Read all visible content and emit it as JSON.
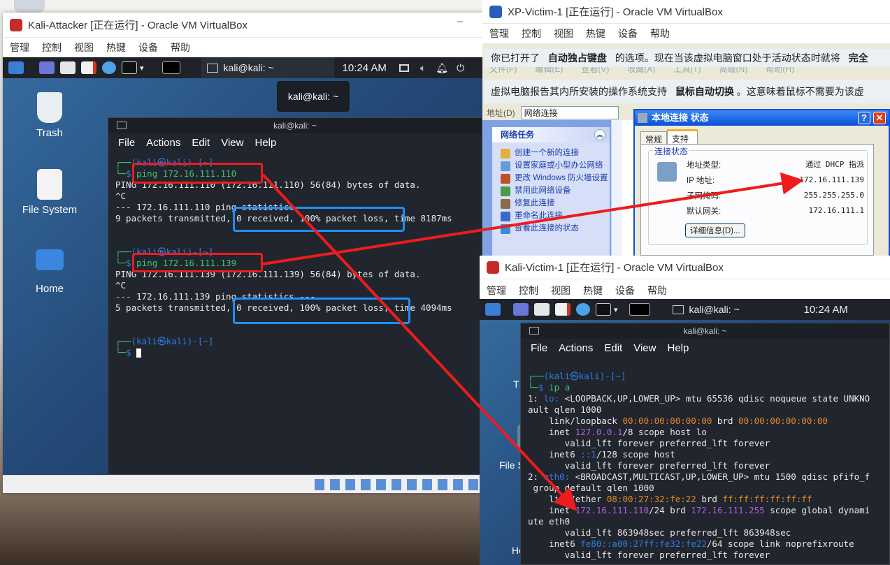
{
  "kali_attacker": {
    "title": "Kali-Attacker [正在运行] - Oracle VM VirtualBox",
    "menu": [
      "管理",
      "控制",
      "视图",
      "热键",
      "设备",
      "帮助"
    ],
    "panel_task": "kali@kali: ~",
    "clock": "10:24 AM",
    "tooltip": "kali@kali: ~",
    "desktop_icons": [
      "Trash",
      "File System",
      "Home"
    ],
    "terminal": {
      "title": "kali@kali: ~",
      "menu": [
        "File",
        "Actions",
        "Edit",
        "View",
        "Help"
      ],
      "prompt1_user": "(kali㉿kali)-[~]",
      "cmd1": "ping 172.16.111.110",
      "out1_1": "PING 172.16.111.110 (172.16.111.110) 56(84) bytes of data.",
      "out1_2": "^C",
      "out1_3": "--- 172.16.111.110 ping statistics ---",
      "out1_4a": "9 packets transmitted,",
      "out1_4b": " 0 received, 100% packet loss,",
      "out1_4c": " time 8187ms",
      "prompt2_user": "(kali㉿kali)-[~]",
      "cmd2": "ping 172.16.111.139",
      "out2_1": "PING 172.16.111.139 (172.16.111.139) 56(84) bytes of data.",
      "out2_2": "^C",
      "out2_3": "--- 172.16.111.139 ping statistics ---",
      "out2_4a": "5 packets transmitted,",
      "out2_4b": " 0 received, 100% packet loss,",
      "out2_4c": " time 4094ms",
      "prompt3_user": "(kali㉿kali)-[~]",
      "prompt_symbol": "$"
    }
  },
  "xp_victim": {
    "title": "XP-Victim-1 [正在运行] - Oracle VM VirtualBox",
    "menu": [
      "管理",
      "控制",
      "视图",
      "热键",
      "设备",
      "帮助"
    ],
    "notice1_a": "你已打开了",
    "notice1_b": "自动独占键盘",
    "notice1_c": "的选项。现在当该虚拟电脑窗口处于活动状态时就将",
    "notice1_d": "完全",
    "notice2_a": "虚拟电脑报告其内所安装的操作系统支持",
    "notice2_b": "鼠标自动切换",
    "notice2_c": "。这意味着鼠标不需要为该虚",
    "xp_menu_ghost": [
      "文件(F)",
      "编辑(E)",
      "查看(V)",
      "收藏(A)",
      "工具(T)",
      "高级(N)",
      "帮助(H)"
    ],
    "address_label": "地址(D)",
    "address_value": "网络连接",
    "tasks_header": "网络任务",
    "tasks": [
      "创建一个新的连接",
      "设置家庭或小型办公网络",
      "更改 Windows 防火墙设置",
      "禁用此网络设备",
      "修复此连接",
      "重命名此连接",
      "查看此连接的状态"
    ],
    "dialog": {
      "title": "本地连接 状态",
      "tabs": [
        "常规",
        "支持"
      ],
      "group": "连接状态",
      "rows": [
        {
          "label": "地址类型:",
          "value": "通过 DHCP 指派"
        },
        {
          "label": "IP 地址:",
          "value": "172.16.111.139"
        },
        {
          "label": "子网掩码:",
          "value": "255.255.255.0"
        },
        {
          "label": "默认网关:",
          "value": "172.16.111.1"
        }
      ],
      "details_button": "详细信息(D)..."
    }
  },
  "kali_victim": {
    "title": "Kali-Victim-1 [正在运行] - Oracle VM VirtualBox",
    "menu": [
      "管理",
      "控制",
      "视图",
      "热键",
      "设备",
      "帮助"
    ],
    "panel_task": "kali@kali: ~",
    "clock": "10:24 AM",
    "terminal": {
      "title": "kali@kali: ~",
      "menu": [
        "File",
        "Actions",
        "Edit",
        "View",
        "Help"
      ],
      "prompt_user": "(kali㉿kali)-[~]",
      "cmd": "ip a",
      "l1a": "1: ",
      "l1b": "lo:",
      "l1c": " <LOOPBACK,UP,LOWER_UP> mtu 65536 qdisc noqueue state UNKNO",
      "l2": "ault qlen 1000",
      "l3a": "    link/loopback ",
      "l3b": "00:00:00:00:00:00",
      "l3c": " brd ",
      "l3d": "00:00:00:00:00:00",
      "l4a": "    inet ",
      "l4b": "127.0.0.1",
      "l4c": "/8 scope host lo",
      "l5": "       valid_lft forever preferred_lft forever",
      "l6a": "    inet6 ",
      "l6b": "::1",
      "l6c": "/128 scope host",
      "l7": "       valid_lft forever preferred_lft forever",
      "l8a": "2: ",
      "l8b": "eth0:",
      "l8c": " <BROADCAST,MULTICAST,UP,LOWER_UP> mtu 1500 qdisc pfifo_f",
      "l9": " group default qlen 1000",
      "l10a": "    link/ether ",
      "l10b": "08:00:27:32:fe:22",
      "l10c": " brd ",
      "l10d": "ff:ff:ff:ff:ff:ff",
      "l11a": "    inet ",
      "l11b": "172.16.111.110",
      "l11c": "/24 brd ",
      "l11d": "172.16.111.255",
      "l11e": " scope global dynami",
      "l12": "ute eth0",
      "l13": "       valid_lft 863948sec preferred_lft 863948sec",
      "l14a": "    inet6 ",
      "l14b": "fe80::a00:27ff:fe32:fe22",
      "l14c": "/64 scope link noprefixroute",
      "l15": "       valid_lft forever preferred_lft forever"
    },
    "desktop_partial": [
      "T",
      "File S",
      "Home"
    ]
  },
  "colors": {
    "kali_blue": "#2f7de1",
    "kali_green": "#3ec76c",
    "ip_purple": "#b05fe0",
    "mac_orange": "#e08a26",
    "annot_red": "#ee1c1c",
    "annot_blue": "#1e8fff"
  }
}
